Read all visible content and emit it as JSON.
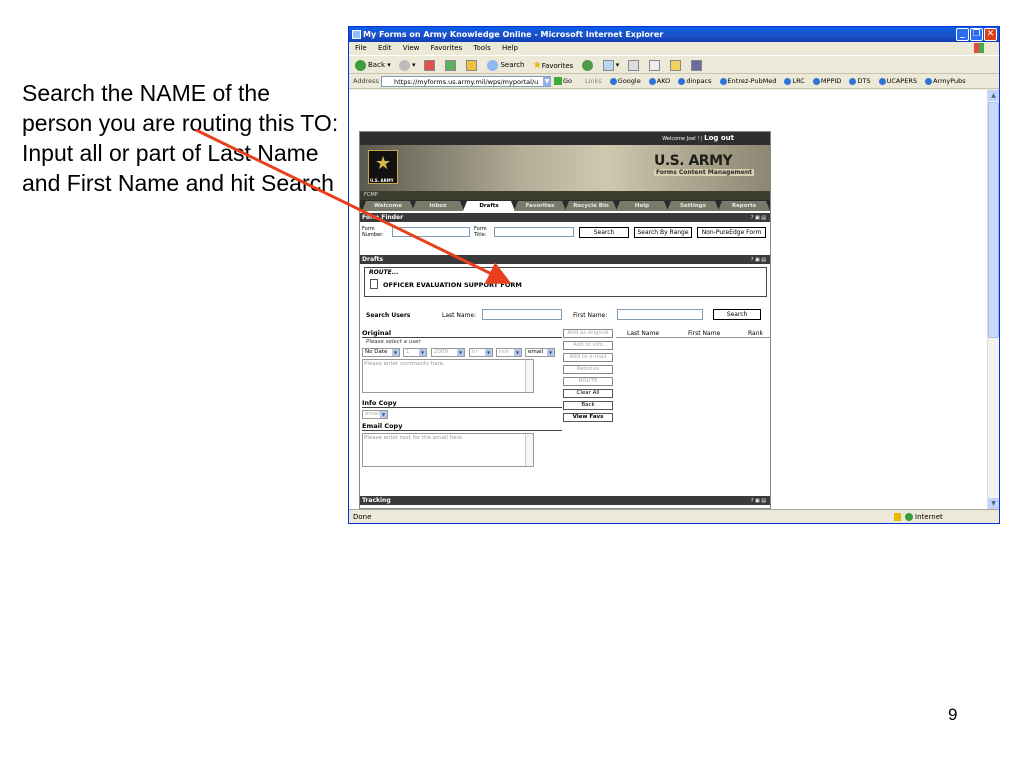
{
  "slide": {
    "instruction": "Search the NAME of the person you are routing this TO:  Input all or part of Last Name and First Name and hit Search",
    "page_number": "9",
    "arrow_color": "#e8401c"
  },
  "browser": {
    "title": "My Forms on Army Knowledge Online - Microsoft Internet Explorer",
    "menu": [
      "File",
      "Edit",
      "View",
      "Favorites",
      "Tools",
      "Help"
    ],
    "toolbar": {
      "back": "Back",
      "search": "Search",
      "favorites": "Favorites"
    },
    "address_label": "Address",
    "address": "https://myforms.us.army.mil/wps/myportal/u",
    "go": "Go",
    "links_label": "Links",
    "links": [
      "Google",
      "AKO",
      "dinpacs",
      "Entrez-PubMed",
      "LRC",
      "MPPID",
      "DTS",
      "UCAPERS",
      "ArmyPubs"
    ],
    "status_text": "Done",
    "status_zone": "Internet"
  },
  "portal": {
    "welcome": "Welcome Joel ! |",
    "logout": "Log out",
    "logo_text": "U.S. ARMY",
    "banner_title": "U.S. ARMY",
    "banner_subtitle": "Forms Content Management",
    "strip": "FCMP",
    "tabs": [
      "Welcome",
      "Inbox",
      "Drafts",
      "Favorites",
      "Recycle Bin",
      "Help",
      "Settings",
      "Reports"
    ],
    "active_tab": "Drafts",
    "panel_controls": "? ▣ ▤",
    "form_finder": {
      "title": "Form Finder",
      "form_number_label_1": "Form",
      "form_number_label_2": "Number:",
      "form_title_label_1": "Form",
      "form_title_label_2": "Title:",
      "search": "Search",
      "search_by_range": "Search By Range",
      "non_pureedge": "Non-PureEdge Form"
    },
    "drafts": {
      "title": "Drafts",
      "route_label": "ROUTE...",
      "form_name": "OFFICER EVALUATION SUPPORT FORM"
    },
    "search_users": {
      "label": "Search Users",
      "last_name_label": "Last Name:",
      "first_name_label": "First Name:",
      "search": "Search"
    },
    "routing": {
      "original_title": "Original",
      "select_hint": "Please select a user",
      "date_select": "No Date",
      "day_select": "1",
      "year_select": "2009",
      "hour_select": "hr",
      "min_select": "min",
      "notify_select": "email",
      "comments_placeholder": "Please enter comments here.",
      "info_copy_title": "Info Copy",
      "info_copy_select": "email",
      "email_copy_title": "Email Copy",
      "email_placeholder": "Please enter text for the email here.",
      "buttons": {
        "add_original": "Add as original",
        "add_info": "Add to info",
        "add_email": "Add to e-mail",
        "remove": "Remove",
        "route": "ROUTE",
        "clear_all": "Clear All",
        "back": "Back",
        "view_favs": "View Favs"
      },
      "columns": [
        "Last Name",
        "First Name",
        "Rank"
      ]
    },
    "tracking_title": "Tracking"
  }
}
